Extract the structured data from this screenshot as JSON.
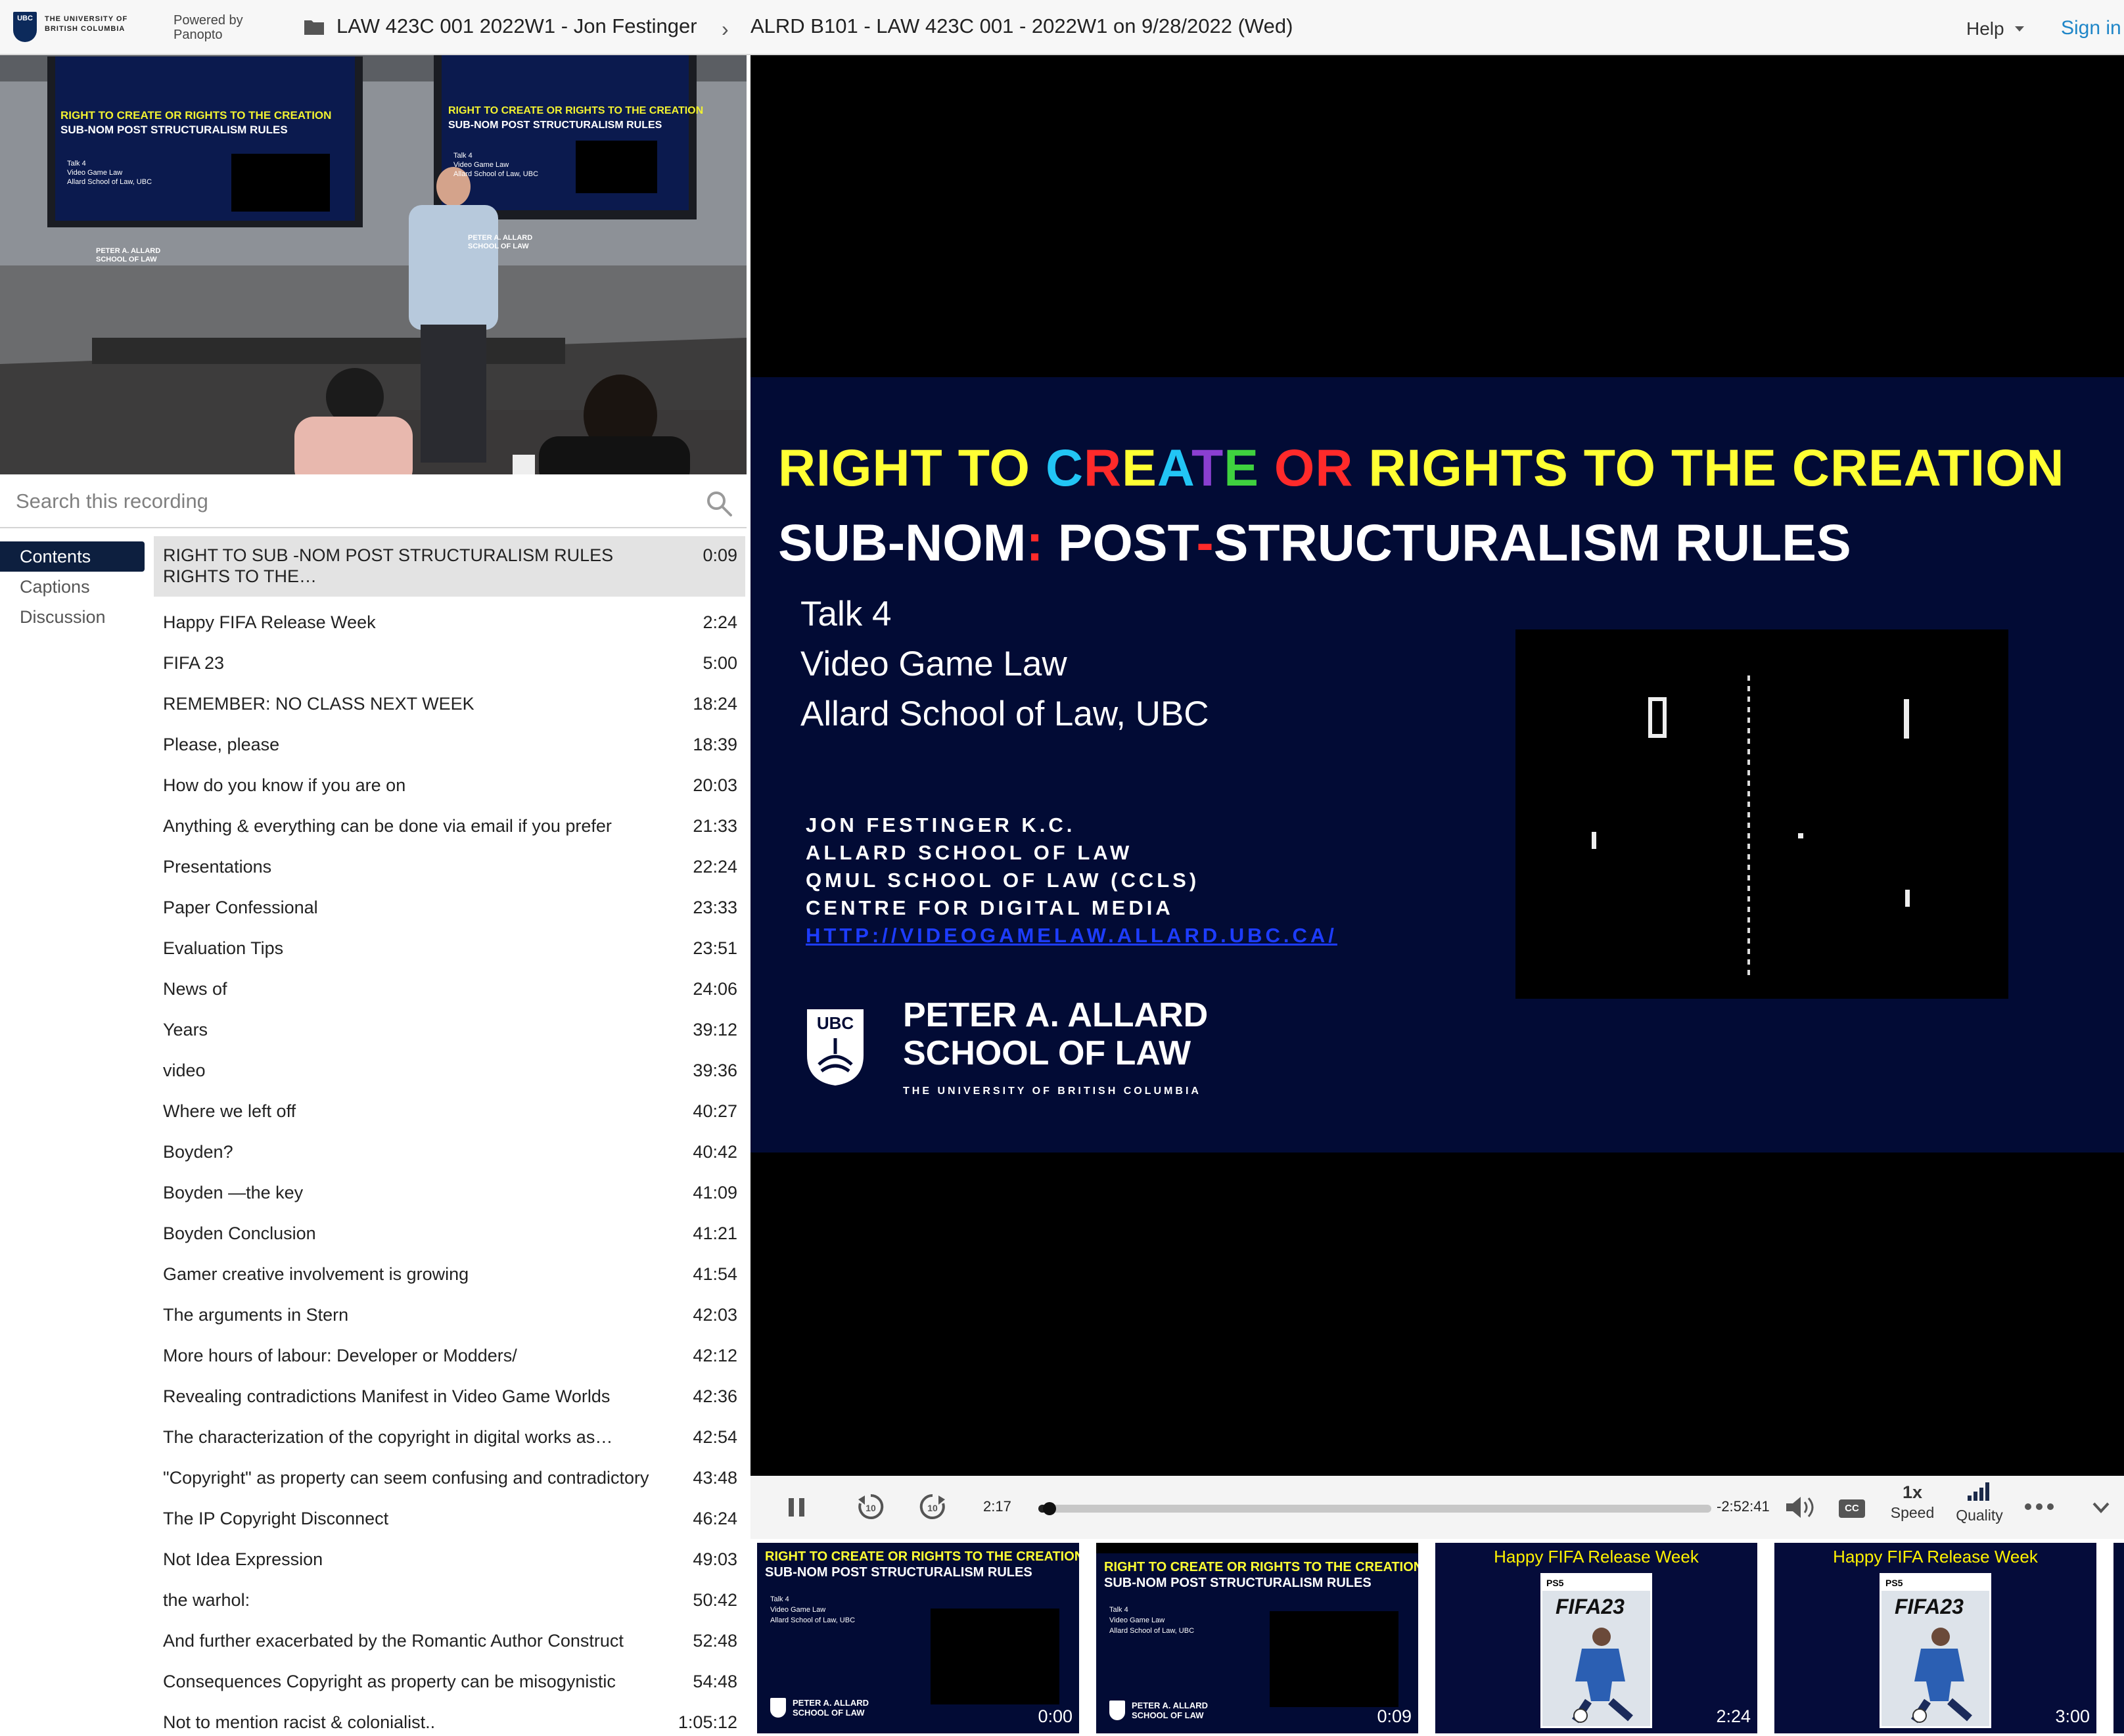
{
  "header": {
    "university_name": "THE UNIVERSITY OF BRITISH COLUMBIA",
    "powered_by": "Powered by Panopto",
    "folder_crumb": "LAW 423C 001 2022W1 - Jon Festinger",
    "session_crumb": "ALRD B101 - LAW 423C 001 - 2022W1 on 9/28/2022 (Wed)",
    "help": "Help",
    "sign_in": "Sign in"
  },
  "search": {
    "placeholder": "Search this recording"
  },
  "tabs": [
    "Contents",
    "Captions",
    "Discussion"
  ],
  "contents": [
    {
      "title": "RIGHT TO SUB -NOM POST STRUCTURALISM RULES",
      "title2": "RIGHTS TO THE…",
      "time": "0:09"
    },
    {
      "title": "Happy FIFA Release Week",
      "time": "2:24"
    },
    {
      "title": "FIFA 23",
      "time": "5:00"
    },
    {
      "title": "REMEMBER: NO CLASS NEXT WEEK",
      "time": "18:24"
    },
    {
      "title": "Please, please",
      "time": "18:39"
    },
    {
      "title": "How do you know if you are on",
      "time": "20:03"
    },
    {
      "title": "Anything & everything can be done via email if you prefer",
      "time": "21:33"
    },
    {
      "title": "Presentations",
      "time": "22:24"
    },
    {
      "title": "Paper Confessional",
      "time": "23:33"
    },
    {
      "title": "Evaluation Tips",
      "time": "23:51"
    },
    {
      "title": "News of",
      "time": "24:06"
    },
    {
      "title": "Years",
      "time": "39:12"
    },
    {
      "title": "video",
      "time": "39:36"
    },
    {
      "title": "Where we left off",
      "time": "40:27"
    },
    {
      "title": "Boyden?",
      "time": "40:42"
    },
    {
      "title": "Boyden —the key",
      "time": "41:09"
    },
    {
      "title": "Boyden Conclusion",
      "time": "41:21"
    },
    {
      "title": "Gamer creative involvement is growing",
      "time": "41:54"
    },
    {
      "title": "The arguments in Stern",
      "time": "42:03"
    },
    {
      "title": "More hours of labour: Developer or Modders/",
      "time": "42:12"
    },
    {
      "title": "Revealing contradictions Manifest in Video Game Worlds",
      "time": "42:36"
    },
    {
      "title": "The characterization of the copyright in digital works as…",
      "time": "42:54"
    },
    {
      "title": "\"Copyright\" as property can seem confusing and contradictory",
      "time": "43:48"
    },
    {
      "title": "The IP Copyright Disconnect",
      "time": "46:24"
    },
    {
      "title": "Not Idea Expression",
      "time": "49:03"
    },
    {
      "title": "the warhol:",
      "time": "50:42"
    },
    {
      "title": "And further exacerbated by the Romantic Author Construct",
      "time": "52:48"
    },
    {
      "title": "Consequences Copyright as property can be misogynistic",
      "time": "54:48"
    },
    {
      "title": "Not to mention racist & colonialist..",
      "time": "1:05:12"
    }
  ],
  "camera_slides": {
    "left": {
      "line1": "RIGHT TO CREATE OR RIGHTS TO THE CREATION",
      "line2": "SUB-NOM POST STRUCTURALISM RULES",
      "talk": "Talk 4",
      "course": "Video Game Law",
      "school": "Allard School of Law, UBC",
      "brand1": "PETER A. ALLARD",
      "brand2": "SCHOOL OF LAW"
    },
    "right": {
      "line1": "RIGHT TO CREATE OR RIGHTS TO THE CREATION",
      "line2": "SUB-NOM POST STRUCTURALISM RULES",
      "talk": "Talk 4",
      "course": "Video Game Law",
      "school": "Allard School of Law, UBC",
      "brand1": "PETER A. ALLARD",
      "brand2": "SCHOOL OF LAW"
    }
  },
  "slide": {
    "title_parts": [
      {
        "text": "RIGHT TO ",
        "color": "#ffff33"
      },
      {
        "text": "C",
        "color": "#22c5f5"
      },
      {
        "text": "R",
        "color": "#ff2a2a"
      },
      {
        "text": "E",
        "color": "#ffff33"
      },
      {
        "text": "A",
        "color": "#22c5f5"
      },
      {
        "text": "T",
        "color": "#8a3fd1"
      },
      {
        "text": "E ",
        "color": "#3fd13f"
      },
      {
        "text": "OR ",
        "color": "#ff2a2a"
      },
      {
        "text": "RIGHTS TO THE CREATION",
        "color": "#ffff33"
      }
    ],
    "subtitle_parts": [
      {
        "text": "SUB-NOM",
        "color": "#ffffff"
      },
      {
        "text": ": ",
        "color": "#ff2a2a"
      },
      {
        "text": "POST",
        "color": "#ffffff"
      },
      {
        "text": "-",
        "color": "#ff2a2a"
      },
      {
        "text": "STRUCTURALISM RULES",
        "color": "#ffffff"
      }
    ],
    "talk": "Talk 4",
    "course": "Video Game Law",
    "school": "Allard School of Law, UBC",
    "credits": [
      "JON FESTINGER K.C.",
      "ALLARD SCHOOL OF LAW",
      "QMUL SCHOOL OF LAW (CCLS)",
      "CENTRE FOR DIGITAL MEDIA"
    ],
    "url": "HTTP://VIDEOGAMELAW.ALLARD.UBC.CA/",
    "brand_line1": "PETER A. ALLARD",
    "brand_line2": "SCHOOL OF LAW",
    "brand_univ": "THE UNIVERSITY OF BRITISH COLUMBIA",
    "crest_text": "UBC",
    "colors": {
      "background": "#020b35",
      "url": "#1d3cff"
    }
  },
  "controls": {
    "elapsed": "2:17",
    "remaining": "-2:52:41",
    "progress_fraction": 0.013,
    "speed_value": "1x",
    "speed_label": "Speed",
    "quality_label": "Quality",
    "cc": "CC"
  },
  "thumbnails": [
    {
      "kind": "slide",
      "line1": "RIGHT TO CREATE OR RIGHTS TO THE CREATION",
      "line2": "SUB-NOM POST STRUCTURALISM RULES",
      "talk": "Talk 4",
      "course": "Video Game Law",
      "school": "Allard School of Law, UBC",
      "brand1": "PETER A. ALLARD",
      "brand2": "SCHOOL OF LAW",
      "time": "0:00"
    },
    {
      "kind": "slide",
      "line1": "RIGHT TO CREATE OR RIGHTS TO THE CREATION",
      "line2": "SUB-NOM POST STRUCTURALISM RULES",
      "talk": "Talk 4",
      "course": "Video Game Law",
      "school": "Allard School of Law, UBC",
      "brand1": "PETER A. ALLARD",
      "brand2": "SCHOOL OF LAW",
      "time": "0:09"
    },
    {
      "kind": "fifa",
      "title": "Happy FIFA Release Week",
      "platform": "PS5",
      "game": "FIFA23",
      "time": "2:24"
    },
    {
      "kind": "fifa",
      "title": "Happy FIFA Release Week",
      "platform": "PS5",
      "game": "FIFA23",
      "time": "3:00"
    }
  ]
}
